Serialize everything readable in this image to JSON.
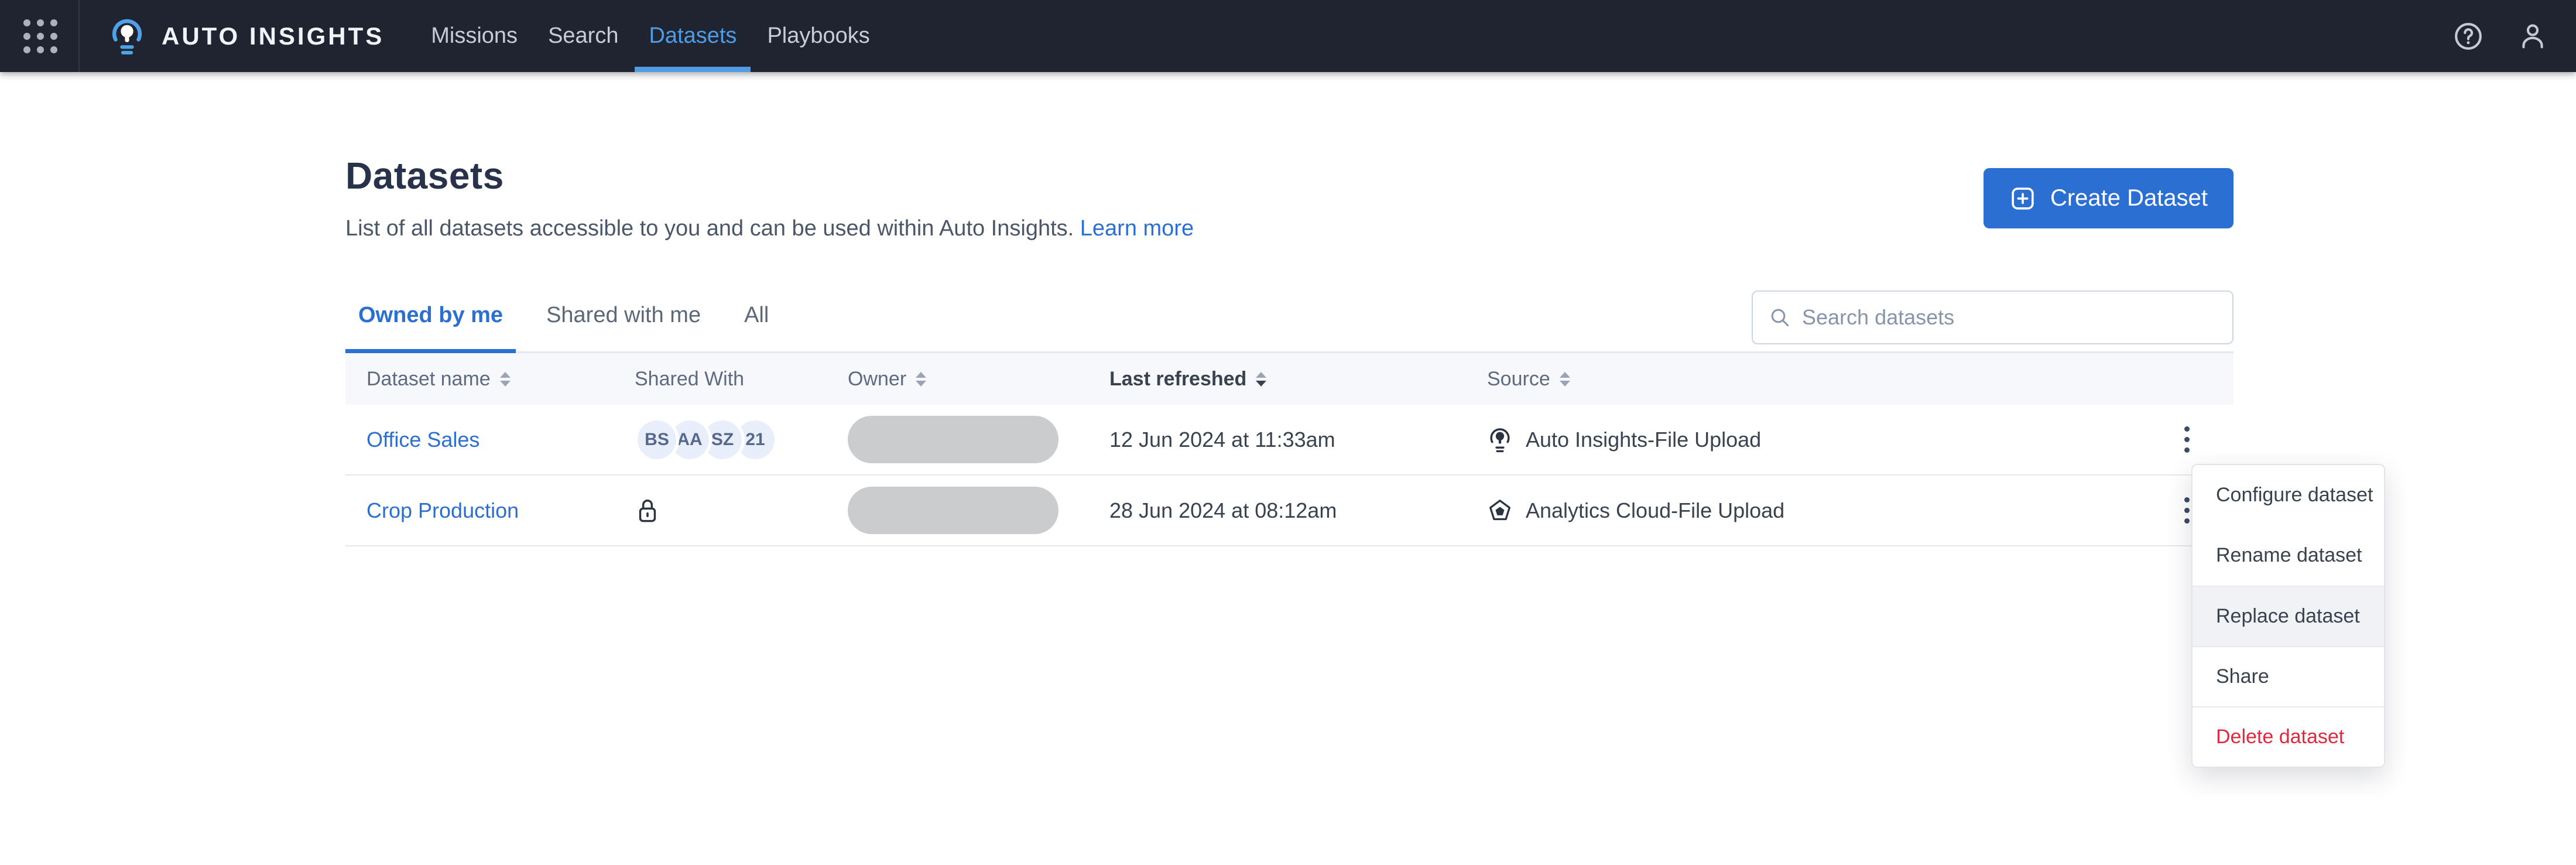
{
  "navbar": {
    "app_title": "AUTO INSIGHTS",
    "items": [
      {
        "label": "Missions",
        "active": false
      },
      {
        "label": "Search",
        "active": false
      },
      {
        "label": "Datasets",
        "active": true
      },
      {
        "label": "Playbooks",
        "active": false
      }
    ],
    "icons": [
      "grid-icon",
      "lightbulb-logo",
      "help-icon",
      "person-icon"
    ]
  },
  "page": {
    "title": "Datasets",
    "description": "List of all datasets accessible to you and can be used within Auto Insights.",
    "learn_more": "Learn more",
    "create_button": "Create Dataset"
  },
  "tabs": [
    {
      "label": "Owned by me",
      "active": true
    },
    {
      "label": "Shared with me",
      "active": false
    },
    {
      "label": "All",
      "active": false
    }
  ],
  "search": {
    "placeholder": "Search datasets"
  },
  "table": {
    "columns": [
      {
        "label": "Dataset name",
        "sortable": true
      },
      {
        "label": "Shared With",
        "sortable": false
      },
      {
        "label": "Owner",
        "sortable": true
      },
      {
        "label": "Last refreshed",
        "sortable": true,
        "sorted": "desc"
      },
      {
        "label": "Source",
        "sortable": true
      }
    ],
    "rows": [
      {
        "name": "Office Sales",
        "shared_with": [
          "BS",
          "AA",
          "SZ",
          "21"
        ],
        "owner": "redacted-pill",
        "last_refreshed": "12 Jun 2024 at 11:33am",
        "source": {
          "icon": "lightbulb",
          "label": "Auto Insights-File Upload"
        }
      },
      {
        "name": "Crop Production",
        "shared_with": "private-lock",
        "owner": "redacted-pill",
        "last_refreshed": "28 Jun 2024 at 08:12am",
        "source": {
          "icon": "analytics-cloud",
          "label": "Analytics Cloud-File Upload"
        }
      }
    ]
  },
  "context_menu": {
    "items": [
      {
        "label": "Configure dataset",
        "state": "default"
      },
      {
        "label": "Rename dataset",
        "state": "default"
      },
      {
        "label": "Replace dataset",
        "state": "highlighted"
      },
      {
        "label": "Share",
        "state": "default"
      },
      {
        "label": "Delete dataset",
        "state": "danger"
      }
    ]
  },
  "colors": {
    "navbar_bg": "#1f2430",
    "nav_active_blue": "#4f9be4",
    "accent_blue": "#2a6fd1",
    "danger_red": "#e02940",
    "heading_navy": "#29324b",
    "table_border": "#e4e8ee",
    "avatar_bg": "#e9eefb",
    "owner_pill_gray": "#cbcccd"
  }
}
